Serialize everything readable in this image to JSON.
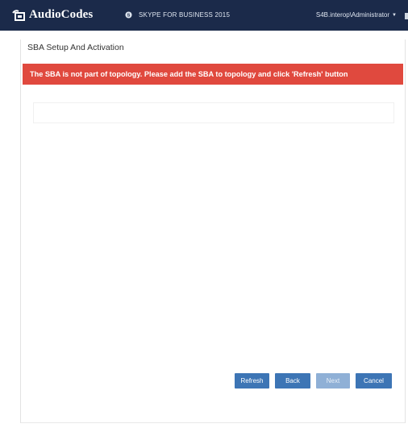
{
  "header": {
    "brand": "AudioCodes",
    "product": "SKYPE FOR BUSINESS 2015",
    "user": "S4B.interop\\Administrator"
  },
  "page": {
    "title": "SBA Setup And Activation",
    "alert": "The SBA is not part of topology. Please add the SBA to topology and click 'Refresh' button"
  },
  "buttons": {
    "refresh": "Refresh",
    "back": "Back",
    "next": "Next",
    "cancel": "Cancel"
  },
  "colors": {
    "header_bg": "#1b2a4a",
    "alert_bg": "#e0493e",
    "button_bg": "#3d75b5",
    "button_disabled_bg": "#8fb0d6"
  },
  "icons": {
    "logo": "audiocodes-logo-icon",
    "product": "skype-icon",
    "user_caret": "chevron-down-icon"
  }
}
